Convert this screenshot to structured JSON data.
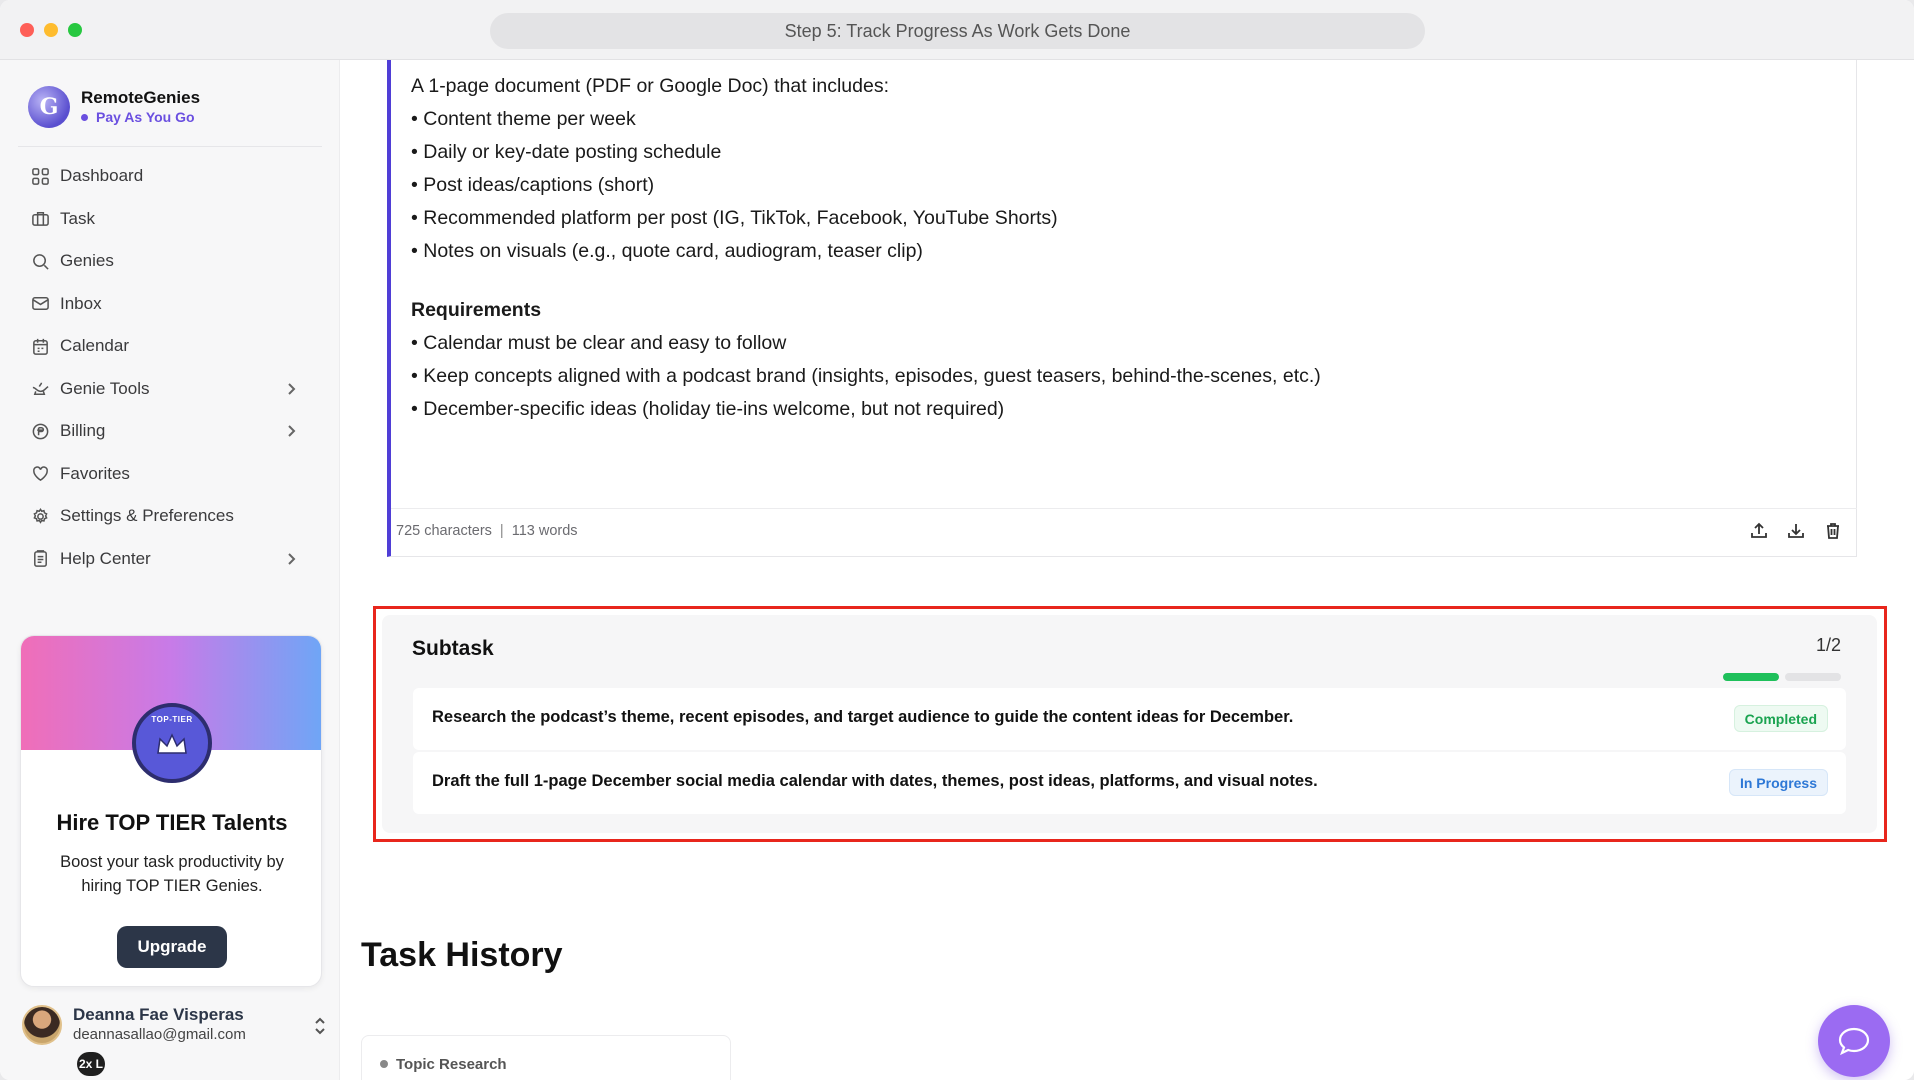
{
  "window": {
    "title": "Step 5: Track Progress As Work Gets Done"
  },
  "brand": {
    "name": "RemoteGenies",
    "plan": "Pay As You Go",
    "logo_letter": "G"
  },
  "sidebar": {
    "items": [
      {
        "label": "Dashboard",
        "icon": "dashboard-icon",
        "has_chevron": false
      },
      {
        "label": "Task",
        "icon": "briefcase-icon",
        "has_chevron": false
      },
      {
        "label": "Genies",
        "icon": "search-icon",
        "has_chevron": false
      },
      {
        "label": "Inbox",
        "icon": "mail-icon",
        "has_chevron": false
      },
      {
        "label": "Calendar",
        "icon": "calendar-icon",
        "has_chevron": false
      },
      {
        "label": "Genie Tools",
        "icon": "lamp-icon",
        "has_chevron": true
      },
      {
        "label": "Billing",
        "icon": "currency-icon",
        "has_chevron": true
      },
      {
        "label": "Favorites",
        "icon": "heart-icon",
        "has_chevron": false
      },
      {
        "label": "Settings & Preferences",
        "icon": "gear-icon",
        "has_chevron": false
      },
      {
        "label": "Help Center",
        "icon": "clipboard-icon",
        "has_chevron": true
      }
    ]
  },
  "promo": {
    "badge_text": "TOP-TIER",
    "title": "Hire TOP TIER Talents",
    "text": "Boost your task productivity by hiring TOP TIER Genies.",
    "button": "Upgrade",
    "colors": {
      "gradient_start": "#f06eb8",
      "gradient_mid": "#c77be8",
      "gradient_end": "#6ea6f6"
    }
  },
  "user": {
    "name": "Deanna Fae Visperas",
    "email": "deannasallao@gmail.com",
    "zoom": "2x L"
  },
  "document": {
    "lines": [
      "A 1-page document (PDF or Google Doc) that includes:",
      "• Content theme per week",
      "• Daily or key-date posting schedule",
      "• Post ideas/captions (short)",
      "• Recommended platform per post (IG, TikTok, Facebook, YouTube Shorts)",
      "• Notes on visuals (e.g., quote card, audiogram, teaser clip)"
    ],
    "requirements_heading": "Requirements",
    "requirements": [
      "• Calendar must be clear and easy to follow",
      "• Keep concepts aligned with a podcast brand (insights, episodes, guest teasers, behind-the-scenes, etc.)",
      "• December-specific ideas (holiday tie-ins welcome, but not required)"
    ],
    "stats": {
      "characters": "725 characters",
      "separator": "|",
      "words": "113 words"
    },
    "actions": [
      "upload-icon",
      "download-icon",
      "trash-icon"
    ],
    "accent_color": "#4f3ed6"
  },
  "subtask": {
    "title": "Subtask",
    "count": "1/2",
    "progress": {
      "completed": 1,
      "total": 2
    },
    "items": [
      {
        "text": "Research the podcast’s theme, recent episodes, and target audience to guide the content ideas for December.",
        "status": "Completed"
      },
      {
        "text": "Draft the full 1-page December social media calendar with dates, themes, post ideas, platforms, and visual notes.",
        "status": "In Progress"
      }
    ],
    "colors": {
      "completed": "#1aa350",
      "in_progress": "#2e78d6",
      "highlight": "#e8261c"
    }
  },
  "history": {
    "title": "Task History",
    "items": [
      {
        "label": "Topic Research"
      }
    ]
  },
  "chat": {
    "icon": "chat-bubble-icon",
    "color": "#9b6bf2"
  }
}
